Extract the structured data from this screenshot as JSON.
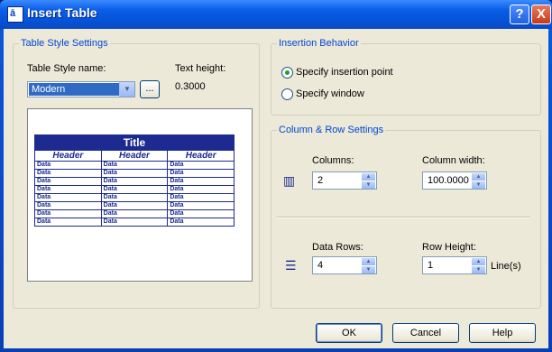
{
  "window": {
    "title": "Insert Table",
    "help": "?",
    "close": "X",
    "icon_char": "ā"
  },
  "style_group": {
    "legend": "Table Style Settings",
    "name_label": "Table Style name:",
    "style_value": "Modern",
    "browse_label": "...",
    "text_height_label": "Text height:",
    "text_height_value": "0.3000"
  },
  "preview": {
    "title": "Title",
    "headers": [
      "Header",
      "Header",
      "Header"
    ],
    "cell": "Data",
    "rows": 8
  },
  "insertion": {
    "legend": "Insertion Behavior",
    "option1": "Specify insertion point",
    "option2": "Specify window",
    "selected": "option1"
  },
  "colrow": {
    "legend": "Column & Row Settings",
    "columns_label": "Columns:",
    "columns_value": "2",
    "colwidth_label": "Column width:",
    "colwidth_value": "100.0000",
    "datarows_label": "Data Rows:",
    "datarows_value": "4",
    "rowheight_label": "Row Height:",
    "rowheight_value": "1",
    "rowheight_unit": "Line(s)"
  },
  "buttons": {
    "ok": "OK",
    "cancel": "Cancel",
    "help": "Help"
  }
}
